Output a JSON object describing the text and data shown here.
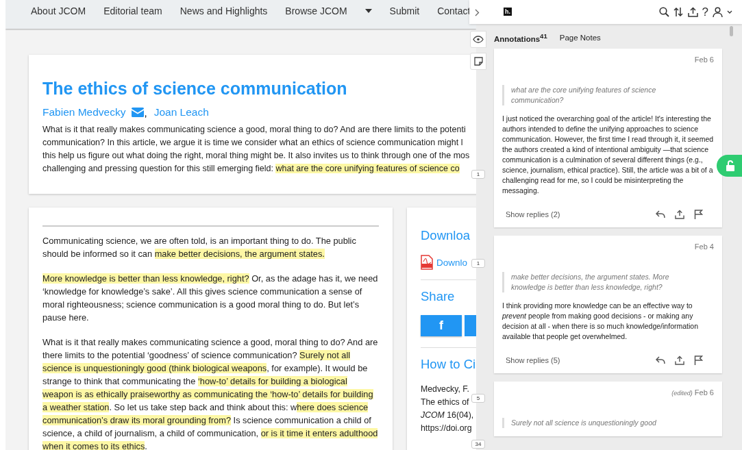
{
  "nav": {
    "items": [
      {
        "label": "About JCOM",
        "dropdown": false
      },
      {
        "label": "Editorial team",
        "dropdown": false
      },
      {
        "label": "News and Highlights",
        "dropdown": false
      },
      {
        "label": "Browse JCOM",
        "dropdown": true
      },
      {
        "label": "Submit",
        "dropdown": false
      },
      {
        "label": "Contact",
        "dropdown": false
      }
    ]
  },
  "article": {
    "title": "The ethics of science communication",
    "authors": [
      {
        "name": "Fabien Medvecky",
        "email": true,
        "separator": ","
      },
      {
        "name": "Joan Leach",
        "email": false
      }
    ],
    "abstract_lines": [
      [
        {
          "text": "What is it that really makes communicating science a good, moral thing to do? And are there limits to the potenti",
          "highlighted": false
        }
      ],
      [
        {
          "text": "communication? In this article, we argue it is time we consider what an ethics of science communication might l",
          "highlighted": false
        }
      ],
      [
        {
          "text": "this help us figure out what doing the right, moral thing might be. It also invites us to think through one of the mos",
          "highlighted": false
        }
      ],
      [
        {
          "text": "challenging and pressing question for this still emerging field: ",
          "highlighted": false
        },
        {
          "text": "what are the core unifying features of science co",
          "highlighted": true
        }
      ]
    ],
    "paragraphs": [
      [
        {
          "text": "Communicating science, we are often told, is an important thing to do. The public should be informed so it can ",
          "highlighted": false
        },
        {
          "text": "make better decisions, the argument states.",
          "highlighted": true
        }
      ],
      [
        {
          "text": "More knowledge is better than less knowledge, right?",
          "highlighted": true
        },
        {
          "text": " Or, as the adage has it, we need ‘knowledge for knowledge’s sake’. All this gives science communication a sense of moral righteousness; science communication is a good moral thing to do. But let’s pause here.",
          "highlighted": false
        }
      ],
      [
        {
          "text": "What is it that really makes communicating science a good, moral thing to do? And are there limits to the potential ‘goodness’ of science communication? ",
          "highlighted": false
        },
        {
          "text": "Surely not all science is unquestioningly good ",
          "highlighted": true
        },
        {
          "text": "(think biological weapons",
          "highlighted": true
        },
        {
          "text": ", for example). It would be strange to think that communicating the ",
          "highlighted": false
        },
        {
          "text": "‘how-to’ details for building a biological weapon is as ethically praiseworthy as communicating the ‘how-to’ details for building a weather station",
          "highlighted": true
        },
        {
          "text": ". So let us take step back and think about this: w",
          "highlighted": false
        },
        {
          "text": "here does science communication’s draw its moral grounding from?",
          "highlighted": true
        },
        {
          "text": " Is science communication a child of science, a child of journalism, a child of communication, ",
          "highlighted": false
        },
        {
          "text": "or is it time it enters adulthood when it comes to its ethics",
          "highlighted": true
        },
        {
          "text": ".",
          "highlighted": false
        }
      ]
    ]
  },
  "aside": {
    "download_heading": "Downloa",
    "download_link": "Downlo",
    "share_heading": "Share",
    "share_button": "f",
    "cite_heading": "How to Ci",
    "cite_lines": [
      "Medvecky, F.",
      "The ethics of",
      "*JCOM* 16(04),",
      "https://doi.org"
    ]
  },
  "bucket_counts": [
    "1",
    "1",
    "5",
    "34"
  ],
  "sidebar": {
    "logo": "h.",
    "help": "?",
    "tabs": [
      {
        "label": "Annotations$^{41}$",
        "selected": true
      },
      {
        "label": "Page Notes",
        "selected": false
      }
    ],
    "annotations": [
      {
        "date": "Feb 6",
        "quote": "what are the core unifying features of science communication?",
        "body": "I just noticed the overarching goal of the article! It's interesting the authors intended to define the unifying approaches to science communication. However, the first time I read through it, it seemed the authors created a kind of intentional ambiguity —that science communication is a culmination of several different things (e.g., science, journalism, ethical practice). Still, the article was a bit of a challenging read for me, so I could be misinterpreting the messaging.",
        "replies": "Show replies (2)"
      },
      {
        "date": "Feb 4",
        "quote": "make better decisions, the argument states. More knowledge is better than less knowledge, right?",
        "body": "I think providing more knowledge can be an effective way to *prevent* people from making good decisions - or making any decision at all - when there is so much knowledge/information available that people get overwhelmed.",
        "replies": "Show replies (5)"
      },
      {
        "edited_label": "(edited)",
        "date": "Feb 6",
        "quote": "Surely not all science is unquestioningly good"
      }
    ]
  }
}
